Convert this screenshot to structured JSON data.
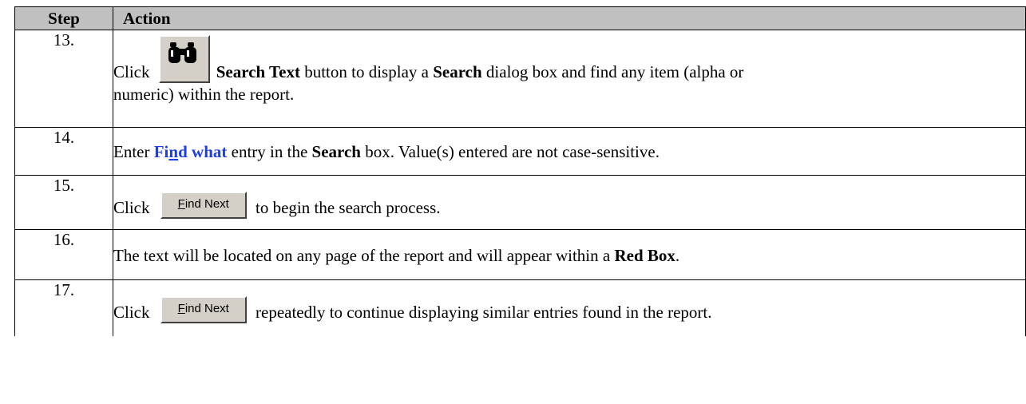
{
  "table": {
    "header": {
      "step": "Step",
      "action": "Action"
    },
    "rows": [
      {
        "num": "13.",
        "pre": "Click ",
        "button_bold": "Search Text",
        "mid": " button to display a ",
        "bold2": "Search",
        "post": " dialog box and find any item (alpha or",
        "line2": "numeric) within the report.",
        "icon": "binoculars-icon"
      },
      {
        "num": "14.",
        "pre": "Enter ",
        "link_a": "Fi",
        "link_u": "n",
        "link_b": "d what",
        "mid": " entry in the ",
        "bold": "Search",
        "post": " box. Value(s) entered are not case-sensitive."
      },
      {
        "num": "15.",
        "pre": "Click ",
        "button_u": "F",
        "button_rest": "ind Next",
        "post": " to begin the search process."
      },
      {
        "num": "16.",
        "pre": "The text will be located on any page of the report and will appear within a ",
        "bold": "Red Box",
        "post": "."
      },
      {
        "num": "17.",
        "pre": "Click ",
        "button_u": "F",
        "button_rest": "ind Next",
        "post": " repeatedly to continue displaying similar entries found in the report."
      }
    ]
  }
}
